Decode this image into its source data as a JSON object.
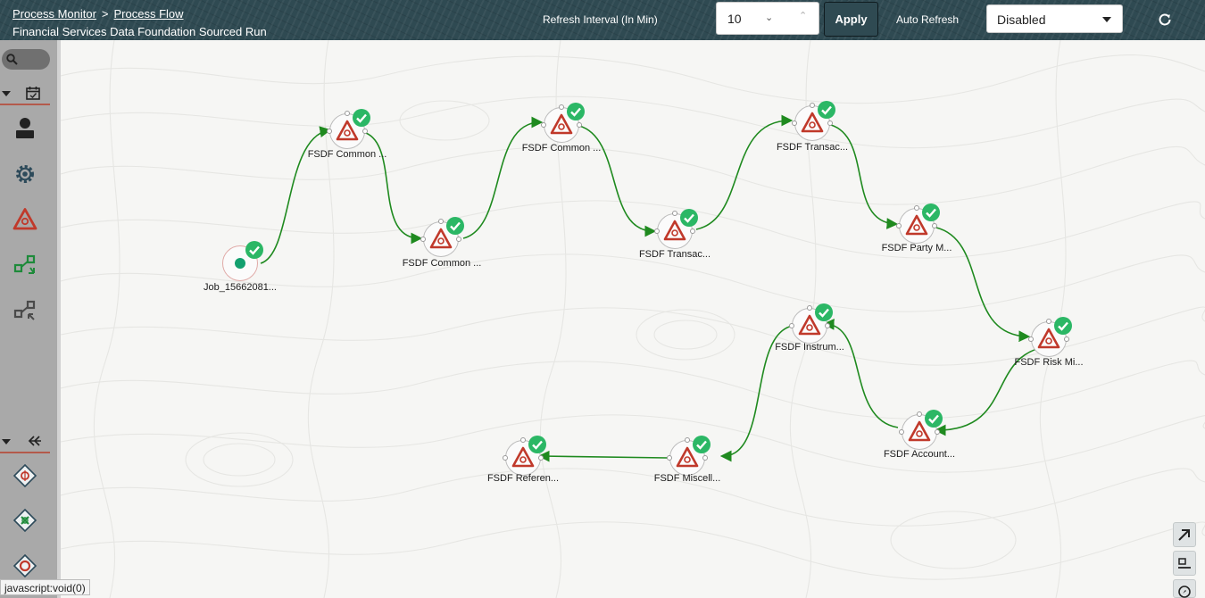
{
  "header": {
    "breadcrumb": [
      "Process Monitor",
      "Process Flow"
    ],
    "breadcrumb_separator": ">",
    "subtitle": "Financial Services Data Foundation Sourced Run",
    "refresh_interval_label": "Refresh Interval (In Min)",
    "refresh_interval_value": "10",
    "apply_label": "Apply",
    "auto_refresh_label": "Auto Refresh",
    "auto_refresh_value": "Disabled"
  },
  "nodes": [
    {
      "id": "start",
      "label": "Job_15662081..."
    },
    {
      "id": "n1",
      "label": "FSDF Common ..."
    },
    {
      "id": "n2",
      "label": "FSDF Common ..."
    },
    {
      "id": "n3",
      "label": "FSDF Common ..."
    },
    {
      "id": "n4",
      "label": "FSDF Transac..."
    },
    {
      "id": "n5",
      "label": "FSDF Transac..."
    },
    {
      "id": "n6",
      "label": "FSDF Party M..."
    },
    {
      "id": "n7",
      "label": "FSDF Risk Mi..."
    },
    {
      "id": "n8",
      "label": "FSDF Account..."
    },
    {
      "id": "n9",
      "label": "FSDF Instrum..."
    },
    {
      "id": "n10",
      "label": "FSDF Miscell..."
    },
    {
      "id": "n11",
      "label": "FSDF Referen..."
    }
  ],
  "status_text": "javascript:void(0)",
  "colors": {
    "header_bg": "#2f4a52",
    "edge": "#1f8a1f",
    "success": "#2bb765",
    "warning_icon": "#c0392b",
    "start_dot": "#13a06f"
  }
}
